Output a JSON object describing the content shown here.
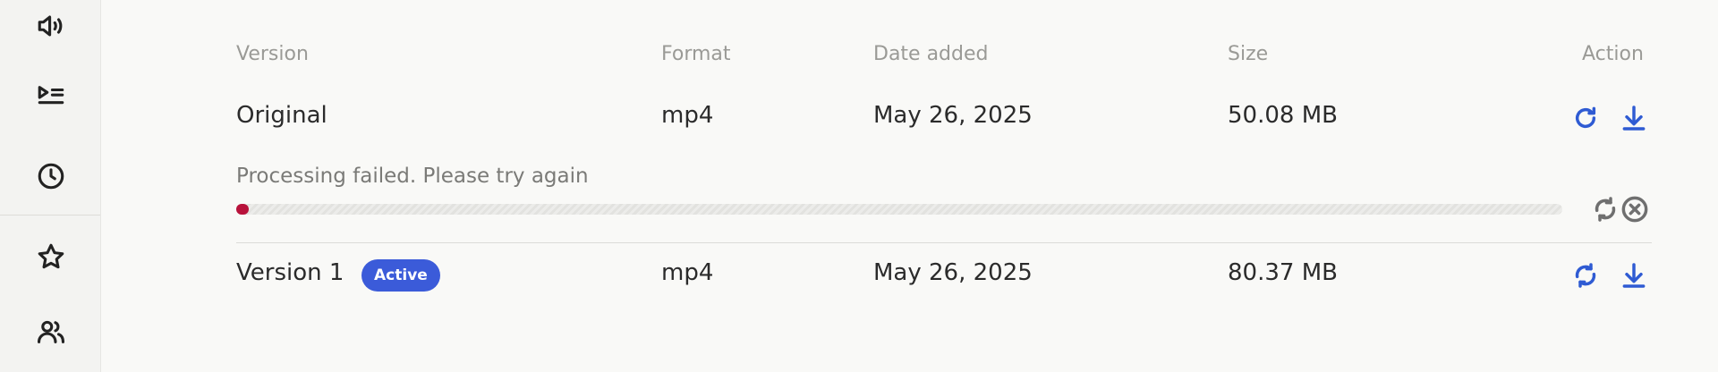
{
  "sidebar": {
    "items": [
      {
        "icon": "speaker-icon"
      },
      {
        "icon": "playlist-icon"
      },
      {
        "icon": "clock-icon"
      },
      {
        "icon": "star-icon"
      },
      {
        "icon": "users-icon"
      }
    ]
  },
  "table": {
    "headers": {
      "version": "Version",
      "format": "Format",
      "date": "Date added",
      "size": "Size",
      "action": "Action"
    },
    "rows": [
      {
        "version": "Original",
        "format": "mp4",
        "date": "May 26, 2025",
        "size": "50.08 MB"
      },
      {
        "version": "Version 1",
        "badge": "Active",
        "format": "mp4",
        "date": "May 26, 2025",
        "size": "80.37 MB"
      }
    ],
    "processing": {
      "message": "Processing failed. Please try again",
      "progress": 0.006
    }
  },
  "colors": {
    "accent": "#2f5bd3",
    "badge_bg": "#3b5bd9",
    "error_fill": "#b8123b"
  }
}
